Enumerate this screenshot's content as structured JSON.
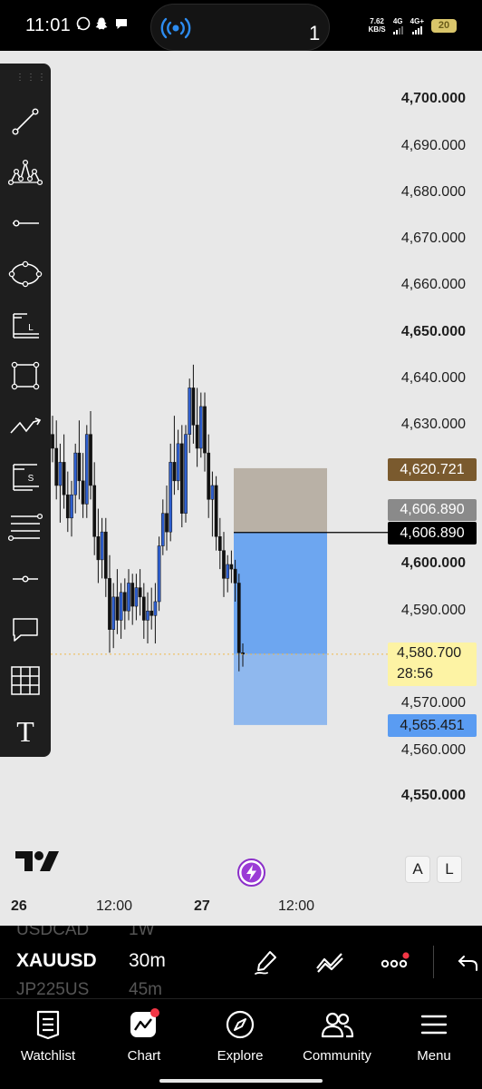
{
  "status_bar": {
    "time": "11:01",
    "notification_icons": [
      "whatsapp-icon",
      "snapchat-icon",
      "chat-icon"
    ],
    "island_badge": "1",
    "net_speed_value": "7.62",
    "net_speed_unit": "KB/S",
    "sim1_label": "4G",
    "sim2_label": "4G+",
    "battery_level": "20"
  },
  "chart": {
    "price_labels": [
      "4,700.000",
      "4,690.000",
      "4,680.000",
      "4,670.000",
      "4,660.000",
      "4,650.000",
      "4,640.000",
      "4,630.000",
      "4,600.000",
      "4,590.000",
      "4,570.000",
      "4,560.000",
      "4,550.000"
    ],
    "tags": {
      "target": "4,620.721",
      "entry_gray": "4,606.890",
      "entry_black": "4,606.890",
      "current_price": "4,580.700",
      "countdown": "28:56",
      "stop": "4,565.451"
    },
    "time_labels": [
      "26",
      "12:00",
      "27",
      "12:00"
    ],
    "scale_buttons": [
      "A",
      "L"
    ],
    "colors": {
      "background": "#e8e8e8",
      "target_zone": "#b9b1a6",
      "stop_zone_upper": "#6da6f0",
      "stop_zone_lower": "#8fb8ee",
      "target_tag": "#7a5a2e",
      "entry_gray_tag": "#8a8a8a",
      "current_tag": "#fdf3a4",
      "stop_tag": "#5a9cf2",
      "candle_bear": "#111111",
      "candle_bull": "#2e5fcf"
    }
  },
  "chart_data": {
    "type": "candlestick",
    "y_range": [
      4546,
      4708
    ],
    "y_ticks": [
      4700,
      4690,
      4680,
      4670,
      4660,
      4650,
      4640,
      4630,
      4600,
      4590,
      4570,
      4560,
      4550
    ],
    "x_labels": [
      "26",
      "12:00",
      "27",
      "12:00"
    ],
    "long_position": {
      "entry": 4606.89,
      "target": 4620.721,
      "stop": 4565.451
    },
    "current_price": 4580.7,
    "candles": [
      {
        "o": 4628,
        "h": 4632,
        "l": 4622,
        "c": 4625
      },
      {
        "o": 4625,
        "h": 4631,
        "l": 4614,
        "c": 4617
      },
      {
        "o": 4617,
        "h": 4626,
        "l": 4609,
        "c": 4622
      },
      {
        "o": 4622,
        "h": 4628,
        "l": 4612,
        "c": 4615
      },
      {
        "o": 4615,
        "h": 4620,
        "l": 4607,
        "c": 4610
      },
      {
        "o": 4610,
        "h": 4618,
        "l": 4606,
        "c": 4615
      },
      {
        "o": 4615,
        "h": 4626,
        "l": 4611,
        "c": 4624
      },
      {
        "o": 4624,
        "h": 4631,
        "l": 4614,
        "c": 4618
      },
      {
        "o": 4618,
        "h": 4624,
        "l": 4610,
        "c": 4613
      },
      {
        "o": 4613,
        "h": 4630,
        "l": 4610,
        "c": 4628
      },
      {
        "o": 4628,
        "h": 4633,
        "l": 4614,
        "c": 4617
      },
      {
        "o": 4617,
        "h": 4622,
        "l": 4602,
        "c": 4606
      },
      {
        "o": 4606,
        "h": 4612,
        "l": 4596,
        "c": 4601
      },
      {
        "o": 4601,
        "h": 4610,
        "l": 4597,
        "c": 4607
      },
      {
        "o": 4607,
        "h": 4610,
        "l": 4593,
        "c": 4597
      },
      {
        "o": 4597,
        "h": 4602,
        "l": 4581,
        "c": 4586
      },
      {
        "o": 4586,
        "h": 4596,
        "l": 4582,
        "c": 4593
      },
      {
        "o": 4593,
        "h": 4599,
        "l": 4585,
        "c": 4588
      },
      {
        "o": 4588,
        "h": 4596,
        "l": 4584,
        "c": 4594
      },
      {
        "o": 4594,
        "h": 4597,
        "l": 4586,
        "c": 4590
      },
      {
        "o": 4590,
        "h": 4599,
        "l": 4588,
        "c": 4596
      },
      {
        "o": 4596,
        "h": 4598,
        "l": 4587,
        "c": 4591
      },
      {
        "o": 4591,
        "h": 4598,
        "l": 4588,
        "c": 4595
      },
      {
        "o": 4595,
        "h": 4599,
        "l": 4589,
        "c": 4593
      },
      {
        "o": 4593,
        "h": 4596,
        "l": 4584,
        "c": 4588
      },
      {
        "o": 4588,
        "h": 4594,
        "l": 4583,
        "c": 4590
      },
      {
        "o": 4590,
        "h": 4595,
        "l": 4586,
        "c": 4589
      },
      {
        "o": 4589,
        "h": 4596,
        "l": 4583,
        "c": 4592
      },
      {
        "o": 4592,
        "h": 4606,
        "l": 4590,
        "c": 4604
      },
      {
        "o": 4604,
        "h": 4614,
        "l": 4602,
        "c": 4611
      },
      {
        "o": 4611,
        "h": 4617,
        "l": 4603,
        "c": 4607
      },
      {
        "o": 4607,
        "h": 4626,
        "l": 4605,
        "c": 4622
      },
      {
        "o": 4622,
        "h": 4632,
        "l": 4615,
        "c": 4618
      },
      {
        "o": 4618,
        "h": 4629,
        "l": 4616,
        "c": 4626
      },
      {
        "o": 4626,
        "h": 4630,
        "l": 4608,
        "c": 4611
      },
      {
        "o": 4611,
        "h": 4630,
        "l": 4609,
        "c": 4628
      },
      {
        "o": 4628,
        "h": 4640,
        "l": 4624,
        "c": 4638
      },
      {
        "o": 4638,
        "h": 4643,
        "l": 4626,
        "c": 4630
      },
      {
        "o": 4630,
        "h": 4638,
        "l": 4621,
        "c": 4625
      },
      {
        "o": 4625,
        "h": 4637,
        "l": 4623,
        "c": 4634
      },
      {
        "o": 4634,
        "h": 4637,
        "l": 4620,
        "c": 4624
      },
      {
        "o": 4624,
        "h": 4628,
        "l": 4610,
        "c": 4614
      },
      {
        "o": 4614,
        "h": 4620,
        "l": 4606,
        "c": 4617
      },
      {
        "o": 4617,
        "h": 4619,
        "l": 4603,
        "c": 4606
      },
      {
        "o": 4606,
        "h": 4610,
        "l": 4599,
        "c": 4603
      },
      {
        "o": 4603,
        "h": 4607,
        "l": 4593,
        "c": 4597
      },
      {
        "o": 4597,
        "h": 4602,
        "l": 4594,
        "c": 4600
      },
      {
        "o": 4600,
        "h": 4603,
        "l": 4596,
        "c": 4599
      },
      {
        "o": 4599,
        "h": 4601,
        "l": 4592,
        "c": 4596
      },
      {
        "o": 4596,
        "h": 4598,
        "l": 4577,
        "c": 4581
      },
      {
        "o": 4581,
        "h": 4583,
        "l": 4578,
        "c": 4580.7
      }
    ]
  },
  "toolbar": {
    "tools": [
      {
        "name": "trend-line-tool-icon"
      },
      {
        "name": "pattern-tool-icon"
      },
      {
        "name": "horizontal-line-tool-icon"
      },
      {
        "name": "ellipse-tool-icon"
      },
      {
        "name": "long-position-tool-icon"
      },
      {
        "name": "rectangle-tool-icon"
      },
      {
        "name": "path-tool-icon"
      },
      {
        "name": "short-position-tool-icon"
      },
      {
        "name": "fib-retracement-tool-icon"
      },
      {
        "name": "ray-tool-icon"
      },
      {
        "name": "callout-tool-icon"
      },
      {
        "name": "grid-tool-icon"
      },
      {
        "name": "text-tool-icon"
      }
    ],
    "long_tool_letter": "L",
    "short_tool_letter": "S",
    "text_tool_letter": "T"
  },
  "symbol_bar": {
    "ghost_above_symbol": "USDCAD",
    "ghost_above_tf": "1W",
    "symbol": "XAUUSD",
    "timeframe": "30m",
    "ghost_below_symbol": "JP225US",
    "ghost_below_tf": "45m"
  },
  "bottom_nav": {
    "items": [
      {
        "label": "Watchlist",
        "icon": "watchlist-icon"
      },
      {
        "label": "Chart",
        "icon": "chart-icon"
      },
      {
        "label": "Explore",
        "icon": "compass-icon"
      },
      {
        "label": "Community",
        "icon": "people-icon"
      },
      {
        "label": "Menu",
        "icon": "menu-icon"
      }
    ]
  }
}
